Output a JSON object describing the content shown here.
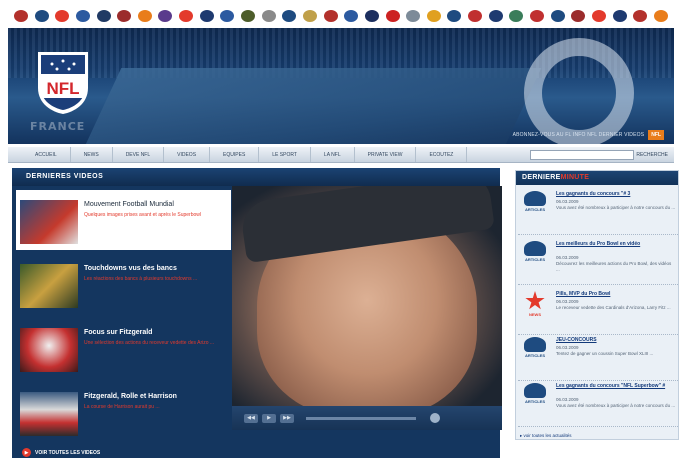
{
  "colors": {
    "accent_red": "#e33a2c",
    "navy": "#14365f",
    "orange": "#e97d1b"
  },
  "team_strip": {
    "logos": [
      "#b3312c",
      "#1e4b80",
      "#e33a2c",
      "#2c5aa0",
      "#203a64",
      "#9b2c2c",
      "#e97d1b",
      "#5a3b8c",
      "#e33a2c",
      "#1e3a70",
      "#2c5aa0",
      "#4d5d2a",
      "#8a8a8a",
      "#1e4b80",
      "#c0a049",
      "#b3312c",
      "#2c5aa0",
      "#1c2f5f",
      "#cc2222",
      "#7d8b99",
      "#e0a020",
      "#1e4b80",
      "#c03030",
      "#1e3a70",
      "#3a7d5a",
      "#c03030",
      "#1e4b80",
      "#9b2c2c",
      "#e33a2c",
      "#1e3a70",
      "#b3312c",
      "#e97d1b"
    ]
  },
  "banner": {
    "france": "FRANCE",
    "subscribe_text": "ABONNEZ-VOUS AU FL INFO NFL DERNIER VIDEOS",
    "subscribe_btn": "NFL"
  },
  "nav": {
    "items": [
      "ACCUEIL",
      "NEWS",
      "DEVE NFL",
      "VIDEOS",
      "EQUIPES",
      "LE SPORT",
      "LA NFL",
      "PRIVATE VIEW",
      "ECOUTEZ"
    ],
    "search_btn": "RECHERCHE"
  },
  "videos": {
    "title": "DERNIERES VIDEOS",
    "items": [
      {
        "title": "Mouvement Football Mundial",
        "desc": "Quelques images prises avant et après le Superbowl"
      },
      {
        "title": "Touchdowns vus des bancs",
        "desc": "Les réactions des bancs à plusieurs touchdowns ..."
      },
      {
        "title": "Focus sur Fitzgerald",
        "desc": "Une sélection des actions du receveur vedette des Arizo ..."
      },
      {
        "title": "Fitzgerald, Rolle et Harrison",
        "desc": "La course de Harrison aurait pu ..."
      }
    ],
    "see_all": "VOIR TOUTES LES VIDEOS"
  },
  "player": {
    "controls": [
      "◀◀",
      "▶",
      "▶▶"
    ]
  },
  "news": {
    "title_a": "DERNIERE",
    "title_b": "MINUTE",
    "items": [
      {
        "icon_label": "ARTICLES",
        "link": "Les gagnants du concours \"# 3",
        "date": "06.03.2009",
        "text": "Vous avez été nombreux à participer à notre concours du ..."
      },
      {
        "icon_label": "ARTICLES",
        "link": "Les meilleurs du Pro Bowl en vidéo",
        "date": "06.03.2009",
        "text": "Découvrez les meilleures actions du Pro Bowl, des vidéos ..."
      },
      {
        "icon_label": "NEWS",
        "link": "Pills, MVP du Pro Bowl",
        "date": "06.03.2009",
        "text": "Le receveur vedette des Cardinals d'Arizona, Larry Fitz ..."
      },
      {
        "icon_label": "ARTICLES",
        "link": "JEU-CONCOURS",
        "date": "06.03.2009",
        "text": "Tentez de gagner un coussin Super Bowl XLIII ..."
      },
      {
        "icon_label": "ARTICLES",
        "link": "Les gagnants du concours \"NFL Superbow\" #",
        "date": "06.03.2009",
        "text": "Vous avez été nombreux à participer à notre concours du ..."
      }
    ],
    "see_all": "▸ voir toutes les actualités"
  }
}
